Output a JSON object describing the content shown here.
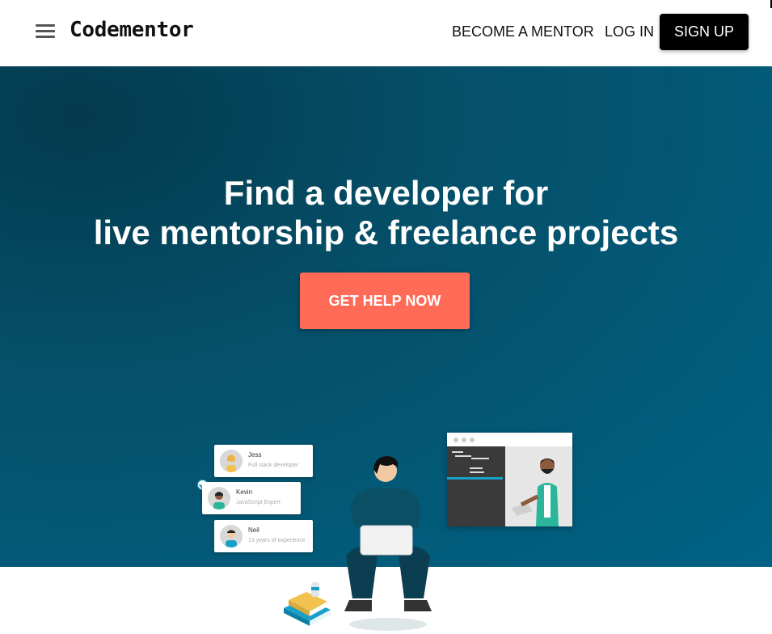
{
  "header": {
    "logo_text": "Codementor",
    "nav": {
      "become_mentor": "BECOME A MENTOR",
      "login": "LOG IN",
      "signup": "SIGN UP"
    },
    "menu_icon": "hamburger-menu-icon"
  },
  "hero": {
    "headline_line1": "Find a developer for",
    "headline_line2": "live mentorship & freelance projects",
    "cta_label": "GET HELP NOW",
    "colors": {
      "background": "#00587a",
      "cta": "#ff6b57"
    }
  },
  "mentor_cards": [
    {
      "name": "Jess",
      "subtitle": "Full stack developer"
    },
    {
      "name": "Kevin",
      "subtitle": "JavaScript Expert"
    },
    {
      "name": "Neil",
      "subtitle": "13 years of experience"
    }
  ]
}
